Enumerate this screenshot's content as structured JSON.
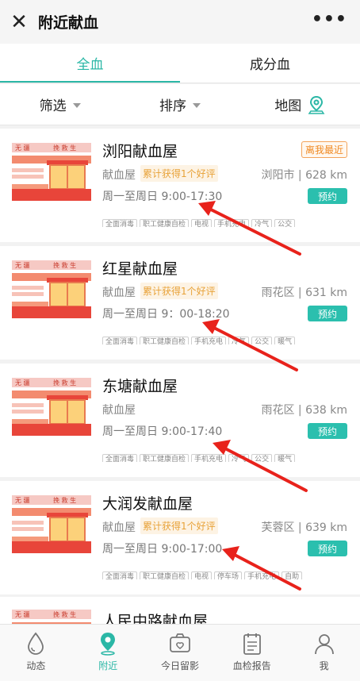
{
  "window": {
    "title": "附近献血",
    "more": "•••"
  },
  "tabs": [
    {
      "label": "全血"
    },
    {
      "label": "成分血"
    }
  ],
  "filters": [
    {
      "label": "筛选"
    },
    {
      "label": "排序"
    },
    {
      "label": "地图"
    }
  ],
  "thumb_text": {
    "left": "无 疆",
    "right": "挽 救 生"
  },
  "stations": [
    {
      "name": "浏阳献血屋",
      "type": "献血屋",
      "review": "累计获得1个好评",
      "location": "浏阳市 | 628 km",
      "badge": "离我最近",
      "hours": "周一至周日 9:00-17:30",
      "book": "预约",
      "tags": [
        "全面消毒",
        "职工健康自检",
        "电视",
        "手机充电",
        "冷气",
        "公交"
      ]
    },
    {
      "name": "红星献血屋",
      "type": "献血屋",
      "review": "累计获得1个好评",
      "location": "雨花区 | 631 km",
      "hours": "周一至周日 9：00-18:20",
      "book": "预约",
      "tags": [
        "全面消毒",
        "职工健康自检",
        "手机充电",
        "冷气",
        "公交",
        "暖气"
      ]
    },
    {
      "name": "东塘献血屋",
      "type": "献血屋",
      "location": "雨花区 | 638 km",
      "hours": "周一至周日 9:00-17:40",
      "book": "预约",
      "tags": [
        "全面消毒",
        "职工健康自检",
        "手机充电",
        "冷气",
        "公交",
        "暖气"
      ]
    },
    {
      "name": "大润发献血屋",
      "type": "献血屋",
      "review": "累计获得1个好评",
      "location": "芙蓉区 | 639 km",
      "hours": "周一至周日 9:00-17:00",
      "book": "预约",
      "tags": [
        "全面消毒",
        "职工健康自检",
        "电视",
        "停车场",
        "手机充电",
        "自助"
      ]
    }
  ],
  "partial_station": {
    "name": "人民中路献血屋"
  },
  "bottom_nav": [
    {
      "label": "动态"
    },
    {
      "label": "附近"
    },
    {
      "label": "今日留影"
    },
    {
      "label": "血检报告"
    },
    {
      "label": "我"
    }
  ],
  "colors": {
    "accent": "#2bb7a6",
    "arrow": "#e8221b",
    "badge_orange": "#f08a24"
  }
}
